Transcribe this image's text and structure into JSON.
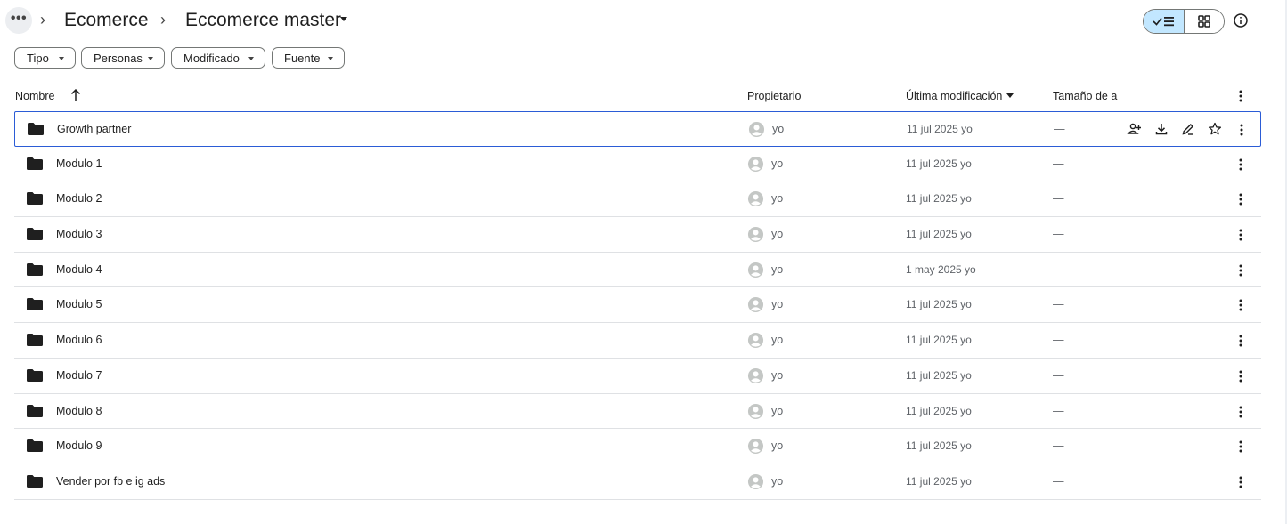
{
  "breadcrumb": {
    "more_icon_text": "•••",
    "items": [
      "Ecomerce",
      "Eccomerce master"
    ],
    "separator": "›"
  },
  "filters": [
    {
      "label": "Tipo"
    },
    {
      "label": "Personas"
    },
    {
      "label": "Modificado"
    },
    {
      "label": "Fuente"
    }
  ],
  "columns": {
    "name": "Nombre",
    "owner": "Propietario",
    "modified": "Última modificación",
    "size": "Tamaño de a"
  },
  "files": [
    {
      "name": "Growth partner",
      "owner": "yo",
      "modified": "11 jul 2025 yo",
      "size": "—"
    },
    {
      "name": "Modulo 1",
      "owner": "yo",
      "modified": "11 jul 2025 yo",
      "size": "—"
    },
    {
      "name": "Modulo 2",
      "owner": "yo",
      "modified": "11 jul 2025 yo",
      "size": "—"
    },
    {
      "name": "Modulo 3",
      "owner": "yo",
      "modified": "11 jul 2025 yo",
      "size": "—"
    },
    {
      "name": "Modulo 4",
      "owner": "yo",
      "modified": "1 may 2025 yo",
      "size": "—"
    },
    {
      "name": "Modulo 5",
      "owner": "yo",
      "modified": "11 jul 2025 yo",
      "size": "—"
    },
    {
      "name": "Modulo 6",
      "owner": "yo",
      "modified": "11 jul 2025 yo",
      "size": "—"
    },
    {
      "name": "Modulo 7",
      "owner": "yo",
      "modified": "11 jul 2025 yo",
      "size": "—"
    },
    {
      "name": "Modulo 8",
      "owner": "yo",
      "modified": "11 jul 2025 yo",
      "size": "—"
    },
    {
      "name": "Modulo 9",
      "owner": "yo",
      "modified": "11 jul 2025 yo",
      "size": "—"
    },
    {
      "name": "Vender por fb e ig ads",
      "owner": "yo",
      "modified": "11 jul 2025 yo",
      "size": "—"
    }
  ],
  "colors": {
    "accent_selected_view": "#c2e7ff",
    "selected_row_border": "#2b5cd6",
    "folder": "#1f1f1f"
  },
  "icons": {
    "breadcrumb_more": "more-horiz-icon",
    "view_list": "check-list-icon",
    "view_grid": "grid-icon",
    "details": "info-icon",
    "row_actions": [
      "share-person-icon",
      "download-icon",
      "rename-icon",
      "star-icon"
    ]
  }
}
